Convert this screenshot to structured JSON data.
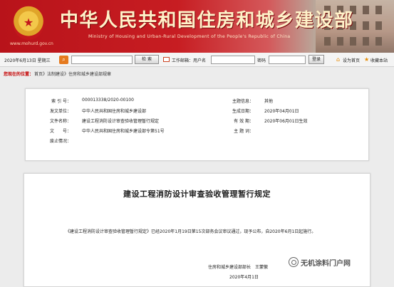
{
  "header": {
    "site_title": "中华人民共和国住房和城乡建设部",
    "site_title_en": "Ministry of Housing and Urban-Rural Development of the People's Republic of China",
    "site_url": "www.mohurd.gov.cn",
    "colors": {
      "banner_red": "#c71d22",
      "title_gold": "#fff2c9"
    }
  },
  "toolbar": {
    "date": "2020年6月13日 星期三",
    "search_button": "检  索",
    "mail_label": "工作邮箱：用户名",
    "password_label": "密码",
    "login_button": "登录",
    "set_home": "设为首页",
    "add_favorite": "收藏本站",
    "search_icon": "search-icon",
    "mail_icon": "mail-icon"
  },
  "breadcrumb": {
    "label": "您现在的位置：",
    "path": "首页》法制建设》住房和城乡建设部规章"
  },
  "meta": {
    "index_no_label": "索 引 号：",
    "index_no": "000013338/2020-00100",
    "topic_label": "主题信息：",
    "topic": "其他",
    "issuer_label": "发文单位：",
    "issuer": "中华人民共和国住房和城乡建设部",
    "created_label": "生成日期：",
    "created": "2020年04月01日",
    "doc_name_label": "文件名称：",
    "doc_name": "建设工程消防设计审查验收管理暂行规定",
    "effective_label": "有 效 期：",
    "effective": "2020年06月01日生效",
    "doc_no_label": "文　　号：",
    "doc_no": "中华人民共和国住房和城乡建设部令第51号",
    "subject_label": "主 题 词：",
    "subject": "",
    "abolished_label": "废止情况："
  },
  "document": {
    "title": "建设工程消防设计审查验收管理暂行规定",
    "body": "《建设工程消防设计审查验收管理暂行规定》已经2020年1月19日第15次部务会议审议通过，现予公布，自2020年6月1日起施行。",
    "signature": "住房和城乡建设部部长　王蒙徽",
    "date": "2020年4月1日"
  },
  "watermark": {
    "text": "无机涂料门户网"
  }
}
